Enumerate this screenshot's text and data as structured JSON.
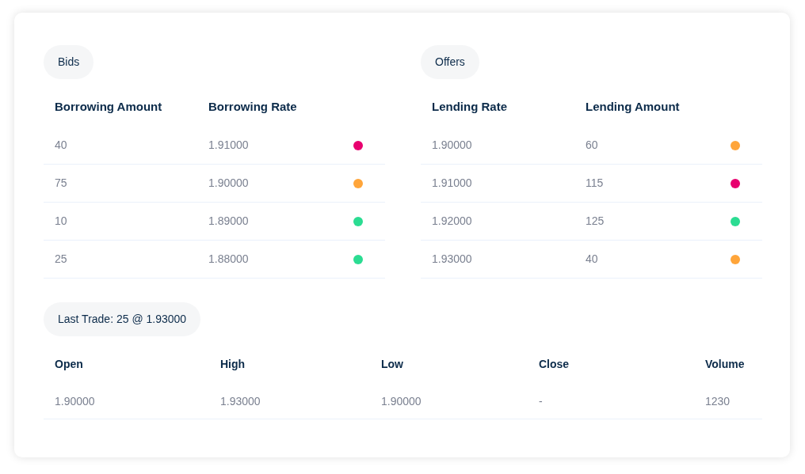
{
  "bids": {
    "label": "Bids",
    "columns": [
      "Borrowing Amount",
      "Borrowing Rate"
    ],
    "rows": [
      {
        "cells": [
          "40",
          "1.91000"
        ],
        "color": "#e8006f"
      },
      {
        "cells": [
          "75",
          "1.90000"
        ],
        "color": "#ffa53a"
      },
      {
        "cells": [
          "10",
          "1.89000"
        ],
        "color": "#2bdc92"
      },
      {
        "cells": [
          "25",
          "1.88000"
        ],
        "color": "#2bdc92"
      }
    ]
  },
  "offers": {
    "label": "Offers",
    "columns": [
      "Lending Rate",
      "Lending Amount"
    ],
    "rows": [
      {
        "cells": [
          "1.90000",
          "60"
        ],
        "color": "#ffa53a"
      },
      {
        "cells": [
          "1.91000",
          "115"
        ],
        "color": "#e8006f"
      },
      {
        "cells": [
          "1.92000",
          "125"
        ],
        "color": "#2bdc92"
      },
      {
        "cells": [
          "1.93000",
          "40"
        ],
        "color": "#ffa53a"
      }
    ]
  },
  "last_trade": {
    "label": "Last Trade: 25 @ 1.93000",
    "columns": [
      "Open",
      "High",
      "Low",
      "Close",
      "Volume"
    ],
    "rows": [
      {
        "cells": [
          "1.90000",
          "1.93000",
          "1.90000",
          "-",
          "1230"
        ]
      }
    ]
  }
}
